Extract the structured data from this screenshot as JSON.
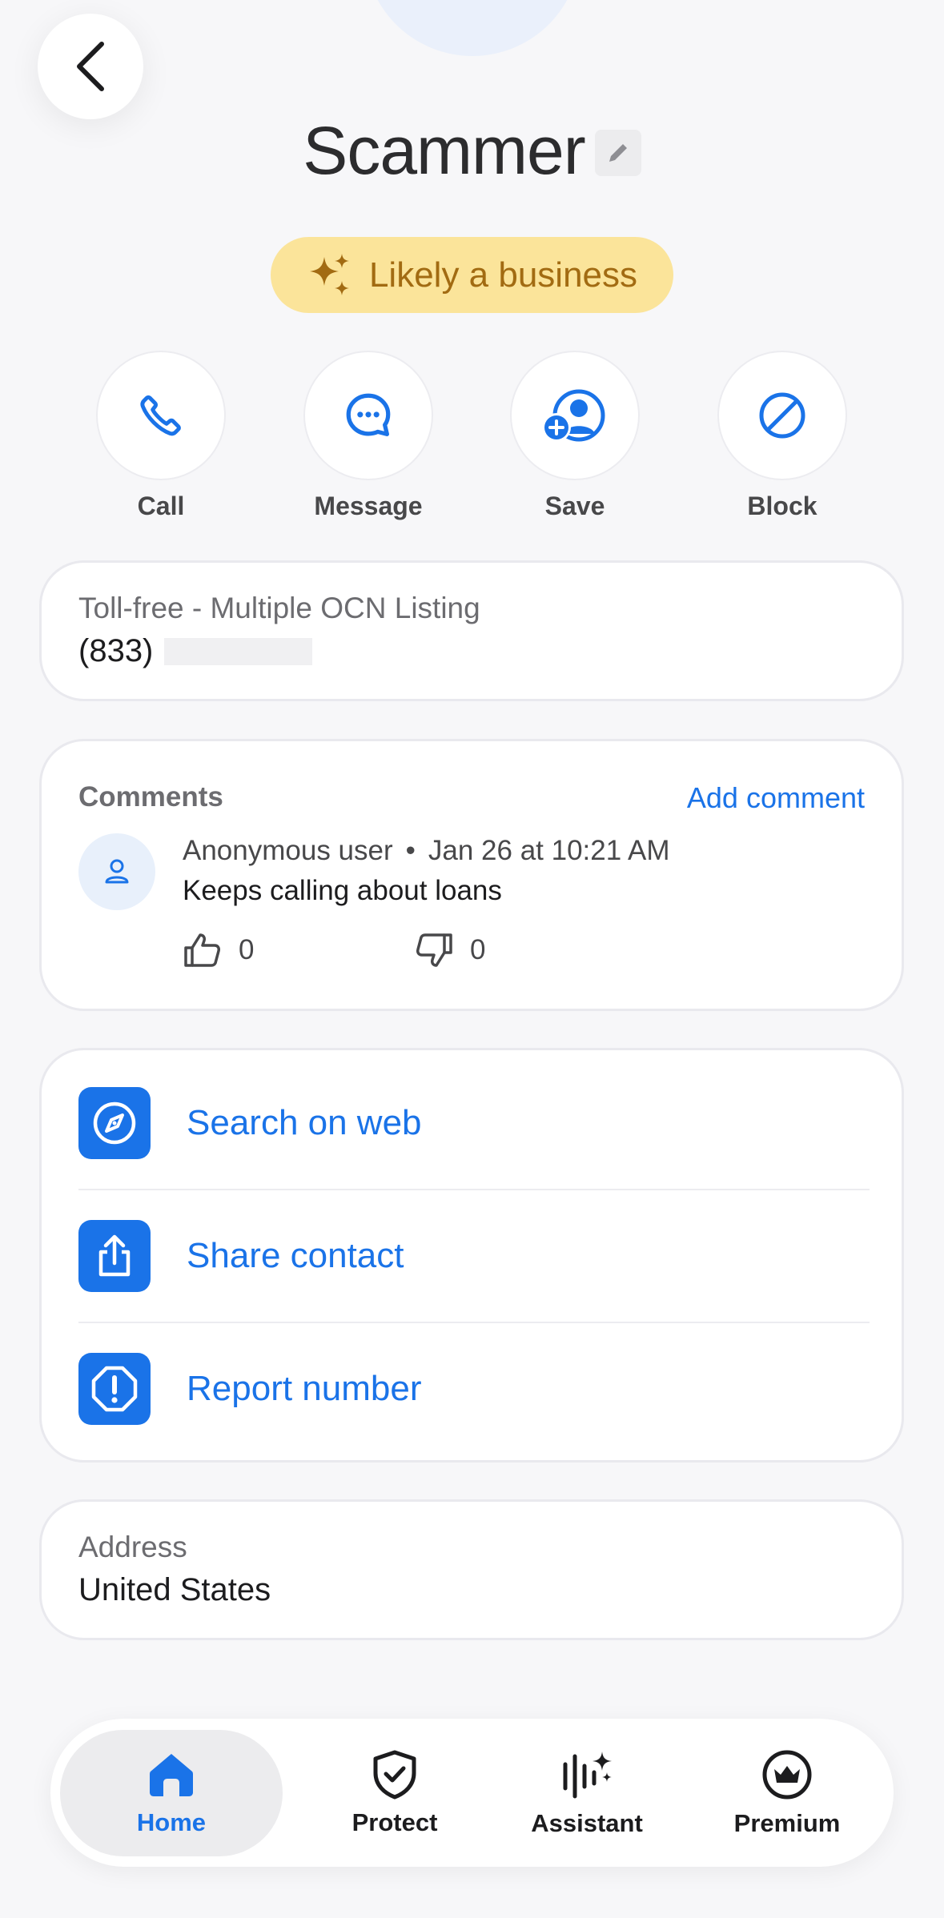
{
  "header": {
    "title": "Scammer",
    "badge": "Likely a business"
  },
  "actions": [
    {
      "label": "Call",
      "icon": "phone-icon"
    },
    {
      "label": "Message",
      "icon": "message-icon"
    },
    {
      "label": "Save",
      "icon": "add-contact-icon"
    },
    {
      "label": "Block",
      "icon": "block-icon"
    }
  ],
  "number_card": {
    "label": "Toll-free - Multiple OCN Listing",
    "prefix": "(833)"
  },
  "comments": {
    "title": "Comments",
    "add_label": "Add comment",
    "items": [
      {
        "author": "Anonymous user",
        "separator": "•",
        "time": "Jan 26 at 10:21 AM",
        "text": "Keeps calling about loans",
        "likes": "0",
        "dislikes": "0"
      }
    ]
  },
  "links": [
    {
      "label": "Search on web",
      "icon": "compass-icon"
    },
    {
      "label": "Share contact",
      "icon": "share-icon"
    },
    {
      "label": "Report number",
      "icon": "report-icon"
    }
  ],
  "address": {
    "label": "Address",
    "value": "United States"
  },
  "tabs": [
    {
      "label": "Home",
      "icon": "home-icon",
      "active": true
    },
    {
      "label": "Protect",
      "icon": "shield-check-icon"
    },
    {
      "label": "Assistant",
      "icon": "assistant-icon"
    },
    {
      "label": "Premium",
      "icon": "crown-icon"
    }
  ],
  "colors": {
    "accent": "#1a73e8",
    "badge_bg": "#fbe49a",
    "badge_text": "#a26b12",
    "background": "#f7f7f9"
  }
}
